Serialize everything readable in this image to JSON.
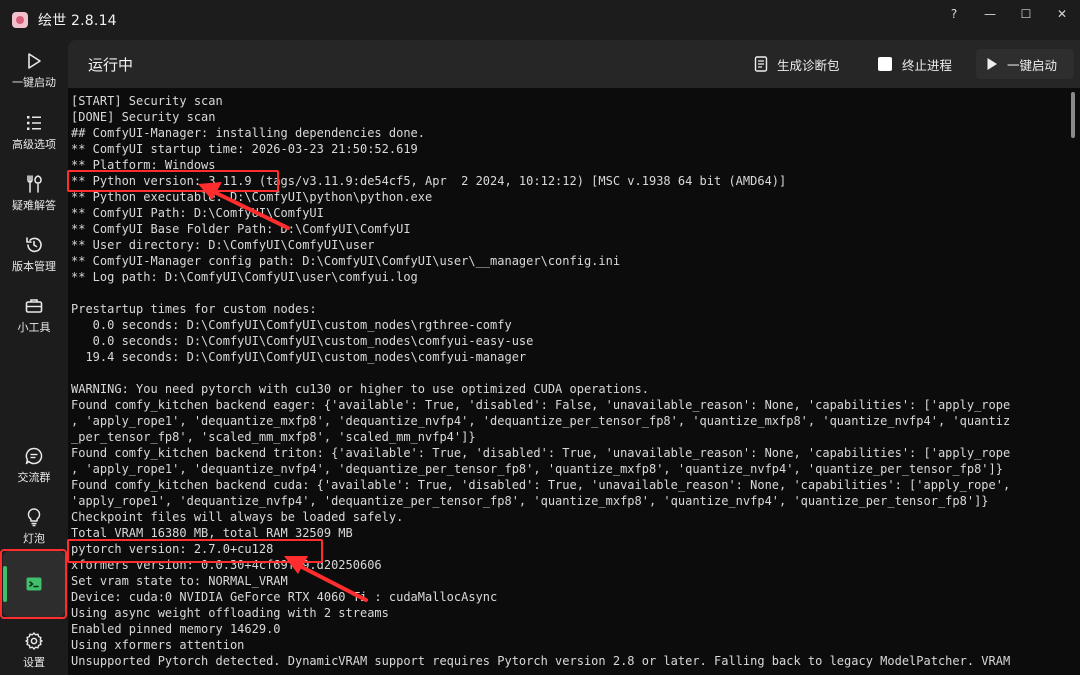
{
  "window": {
    "title": "绘世 2.8.14",
    "controls": {
      "help": "?",
      "minimize": "—",
      "maximize": "☐",
      "close": "✕"
    }
  },
  "sidebar": {
    "items": [
      {
        "label": "一键启动",
        "icon": "play-icon"
      },
      {
        "label": "高级选项",
        "icon": "list-icon"
      },
      {
        "label": "疑难解答",
        "icon": "tools-icon"
      },
      {
        "label": "版本管理",
        "icon": "history-icon"
      },
      {
        "label": "小工具",
        "icon": "toolbox-icon"
      },
      {
        "label": "交流群",
        "icon": "chat-icon"
      },
      {
        "label": "灯泡",
        "icon": "lightbulb-icon"
      },
      {
        "label": "",
        "icon": "console-icon",
        "active": true
      },
      {
        "label": "设置",
        "icon": "gear-icon"
      }
    ],
    "active_color": "#3fbf6a"
  },
  "toolbar": {
    "title": "运行中",
    "diagnose_label": "生成诊断包",
    "stop_label": "终止进程",
    "start_label": "一键启动"
  },
  "console": {
    "lines": [
      "[START] Security scan",
      "[DONE] Security scan",
      "## ComfyUI-Manager: installing dependencies done.",
      "** ComfyUI startup time: 2026-03-23 21:50:52.619",
      "** Platform: Windows",
      "** Python version: 3.11.9 (tags/v3.11.9:de54cf5, Apr  2 2024, 10:12:12) [MSC v.1938 64 bit (AMD64)]",
      "** Python executable: D:\\ComfyUI\\python\\python.exe",
      "** ComfyUI Path: D:\\ComfyUI\\ComfyUI",
      "** ComfyUI Base Folder Path: D:\\ComfyUI\\ComfyUI",
      "** User directory: D:\\ComfyUI\\ComfyUI\\user",
      "** ComfyUI-Manager config path: D:\\ComfyUI\\ComfyUI\\user\\__manager\\config.ini",
      "** Log path: D:\\ComfyUI\\ComfyUI\\user\\comfyui.log",
      "",
      "Prestartup times for custom nodes:",
      "   0.0 seconds: D:\\ComfyUI\\ComfyUI\\custom_nodes\\rgthree-comfy",
      "   0.0 seconds: D:\\ComfyUI\\ComfyUI\\custom_nodes\\comfyui-easy-use",
      "  19.4 seconds: D:\\ComfyUI\\ComfyUI\\custom_nodes\\comfyui-manager",
      "",
      "WARNING: You need pytorch with cu130 or higher to use optimized CUDA operations.",
      "Found comfy_kitchen backend eager: {'available': True, 'disabled': False, 'unavailable_reason': None, 'capabilities': ['apply_rope",
      ", 'apply_rope1', 'dequantize_mxfp8', 'dequantize_nvfp4', 'dequantize_per_tensor_fp8', 'quantize_mxfp8', 'quantize_nvfp4', 'quantiz",
      "_per_tensor_fp8', 'scaled_mm_mxfp8', 'scaled_mm_nvfp4']}",
      "Found comfy_kitchen backend triton: {'available': True, 'disabled': True, 'unavailable_reason': None, 'capabilities': ['apply_rope",
      ", 'apply_rope1', 'dequantize_nvfp4', 'dequantize_per_tensor_fp8', 'quantize_mxfp8', 'quantize_nvfp4', 'quantize_per_tensor_fp8']}",
      "Found comfy_kitchen backend cuda: {'available': True, 'disabled': True, 'unavailable_reason': None, 'capabilities': ['apply_rope',",
      "'apply_rope1', 'dequantize_nvfp4', 'dequantize_per_tensor_fp8', 'quantize_mxfp8', 'quantize_nvfp4', 'quantize_per_tensor_fp8']}",
      "Checkpoint files will always be loaded safely.",
      "Total VRAM 16380 MB, total RAM 32509 MB",
      "pytorch version: 2.7.0+cu128",
      "xformers version: 0.0.30+4cf69f09.d20250606",
      "Set vram state to: NORMAL_VRAM",
      "Device: cuda:0 NVIDIA GeForce RTX 4060 Ti : cudaMallocAsync",
      "Using async weight offloading with 2 streams",
      "Enabled pinned memory 14629.0",
      "Using xformers attention",
      "Unsupported Pytorch detected. DynamicVRAM support requires Pytorch version 2.8 or later. Falling back to legacy ModelPatcher. VRAM"
    ]
  },
  "annotation_color": "#ff2d2d"
}
